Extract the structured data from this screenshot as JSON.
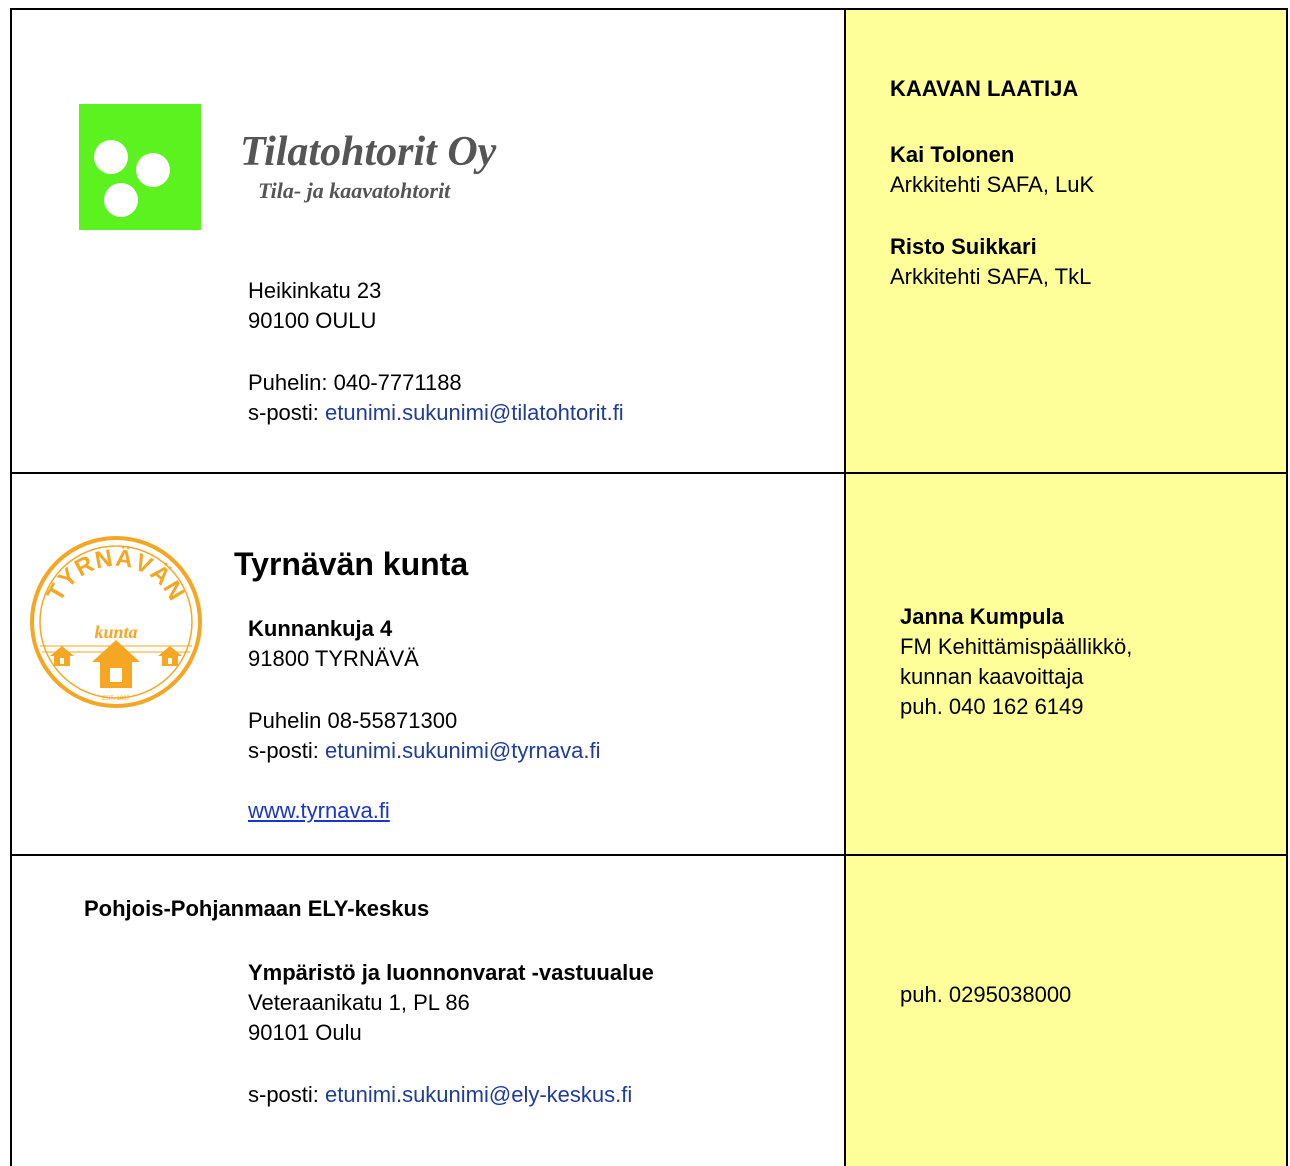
{
  "tilatohtorit": {
    "company": "Tilatohtorit Oy",
    "subtitle": "Tila- ja kaavatohtorit",
    "address_line1": "Heikinkatu 23",
    "address_line2": "90100 OULU",
    "phone": "Puhelin: 040-7771188",
    "email_label": "s-posti: ",
    "email": "etunimi.sukunimi@tilatohtorit.fi",
    "logo_color": "#5cf21f"
  },
  "authors": {
    "heading": "KAAVAN LAATIJA",
    "person1_name": "Kai Tolonen",
    "person1_title": "Arkkitehti SAFA, LuK",
    "person2_name": "Risto Suikkari",
    "person2_title": "Arkkitehti SAFA, TkL"
  },
  "tyrnava": {
    "title": "Tyrnävän kunta",
    "street": "Kunnankuja 4",
    "postal": "91800 TYRNÄVÄ",
    "phone": "Puhelin 08-55871300",
    "email_label": "s-posti: ",
    "email": "etunimi.sukunimi@tyrnava.fi",
    "website": "www.tyrnava.fi",
    "logo_text_top": "TYRNÄVÄN",
    "logo_text_mid": "kunta",
    "logo_text_est": "EST. 1867",
    "logo_color": "#f5a623"
  },
  "tyrnava_contact": {
    "name": "Janna Kumpula",
    "title_line1": "FM Kehittämispäällikkö,",
    "title_line2": "kunnan kaavoittaja",
    "phone": "puh. 040 162 6149"
  },
  "ely": {
    "heading": "Pohjois-Pohjanmaan ELY-keskus",
    "unit": "Ympäristö ja luonnonvarat -vastuualue",
    "street": "Veteraanikatu 1, PL 86",
    "postal": "90101 Oulu",
    "email_label": "s-posti: ",
    "email": "etunimi.sukunimi@ely-keskus.fi"
  },
  "ely_contact": {
    "phone": "puh. 0295038000"
  },
  "colors": {
    "sidebar_bg": "#ffff99",
    "link": "#1f3c99"
  }
}
